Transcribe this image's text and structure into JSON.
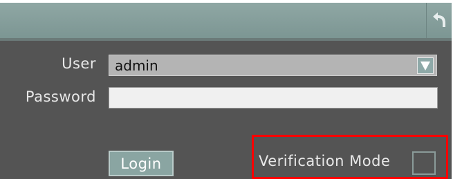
{
  "form": {
    "user_label": "User",
    "user_value": "admin",
    "password_label": "Password",
    "password_value": "",
    "login_label": "Login",
    "verification_label": "Verification Mode",
    "verification_checked": false
  },
  "icons": {
    "back": "back-arrow-icon",
    "dropdown": "triangle-down-icon"
  },
  "colors": {
    "panel": "#545454",
    "titlebar": "#7c9693",
    "accent": "#8aa5a2",
    "highlight": "#ff0000"
  }
}
